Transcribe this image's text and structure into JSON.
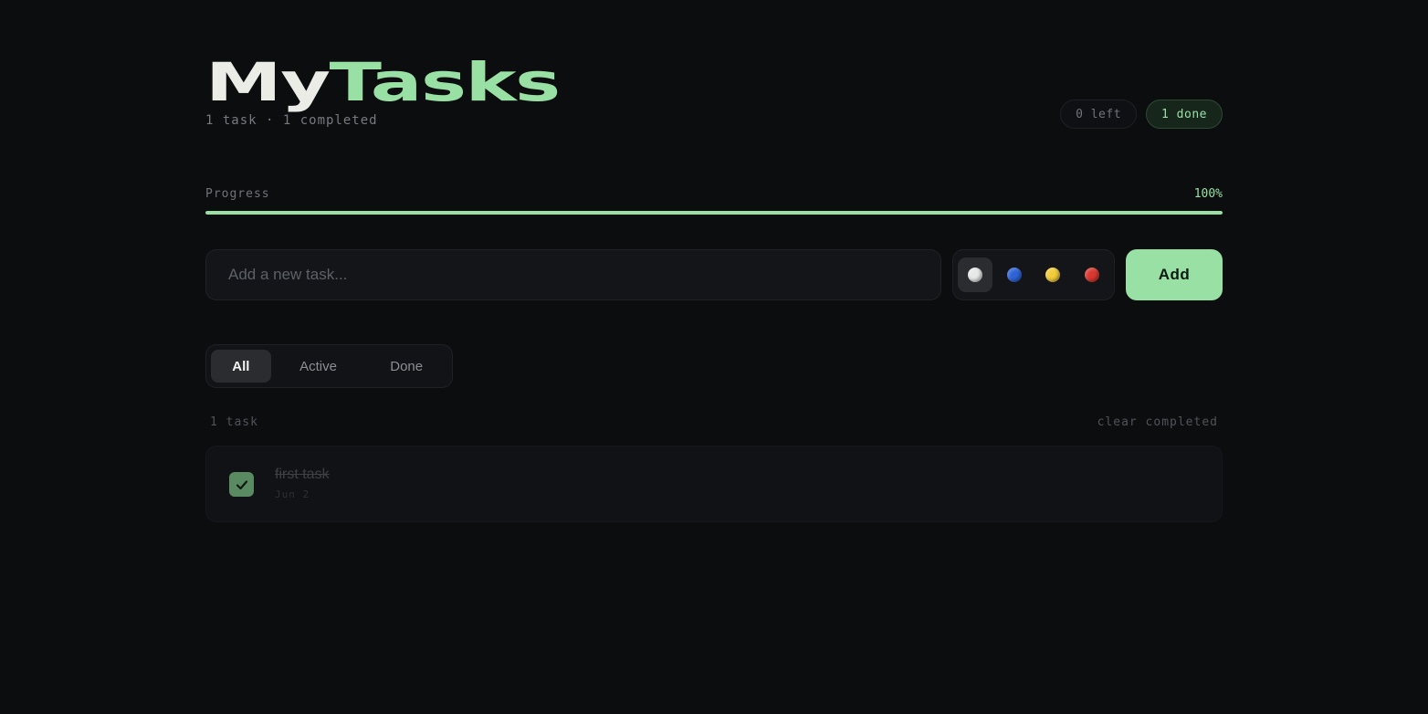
{
  "header": {
    "title_part1": "My",
    "title_part2": "Tasks",
    "subtitle": "1 task · 1 completed",
    "badge_left": "0 left",
    "badge_done": "1 done"
  },
  "progress": {
    "label": "Progress",
    "percent_text": "100%",
    "value": 1.0
  },
  "new_task": {
    "placeholder": "Add a new task...",
    "value": "",
    "add_label": "Add",
    "colors": [
      {
        "name": "white",
        "hex": "#e8e8e8",
        "selected": true
      },
      {
        "name": "blue",
        "hex": "#2f63d8",
        "selected": false
      },
      {
        "name": "yellow",
        "hex": "#f2cc3a",
        "selected": false
      },
      {
        "name": "red",
        "hex": "#d8382f",
        "selected": false
      }
    ]
  },
  "filters": {
    "tabs": [
      {
        "label": "All",
        "active": true
      },
      {
        "label": "Active",
        "active": false
      },
      {
        "label": "Done",
        "active": false
      }
    ]
  },
  "list": {
    "count_text": "1 task",
    "clear_label": "clear completed",
    "items": [
      {
        "text": "first task",
        "date": "Jun 2",
        "done": true
      }
    ]
  },
  "theme": {
    "accent": "#98e0a4",
    "background": "#0c0d0f"
  }
}
